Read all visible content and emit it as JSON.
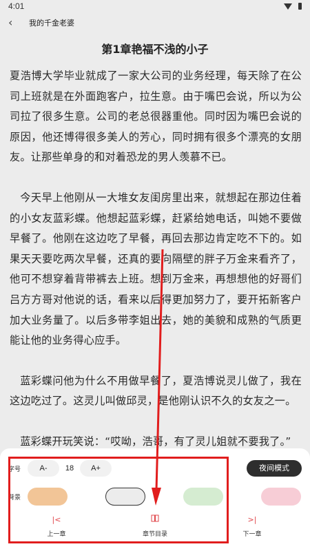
{
  "status_bar": {
    "time": "4:01",
    "icons": [
      "wifi-icon",
      "battery-icon"
    ]
  },
  "header": {
    "back_icon": "chevron-left-icon",
    "title": "我的千金老婆"
  },
  "chapter": {
    "title": "第1章艳福不浅的小子",
    "paragraphs": [
      "夏浩博大学毕业就成了一家大公司的业务经理，每天除了在公司上班就是在外面跑客户，拉生意。由于嘴巴会说，所以为公司拉了很多生意。公司的老总很器重他。同时因为嘴巴会说的原因，他还博得很多美人的芳心，同时拥有很多个漂亮的女朋友。让那些单身的和对着恐龙的男人羡慕不已。",
      "今天早上他刚从一大堆女友闺房里出来，就想起在那边住着的小女友蓝彩蝶。他想起蓝彩蝶，赶紧给她电话，叫她不要做早餐了。他刚在这边吃了早餐，再回去那边肯定吃不下的。如果天天要吃两次早餐，还真的要向隔壁的胖子万金来看齐了，他可不想穿着背带裤去上班。想到万金来，再想想他的好哥们吕方方哥对他说的话，看来以后得更加努力了，要开拓新客户加大业务量了。以后多带李姐出去，她的美貌和成熟的气质更能让他的业务得心应手。",
      "蓝彩蝶问他为什么不用做早餐了，夏浩博说灵儿做了，我在这边吃过了。这灵儿叫做邱灵，是他刚认识不久的女友之一。",
      "蓝彩蝶开玩笑说：“哎呦，浩哥，有了灵儿姐就不要我了。”"
    ]
  },
  "settings": {
    "font_label": "字号",
    "font_decrease": "A-",
    "font_size": "18",
    "font_increase": "A+",
    "night_mode": "夜间模式",
    "bg_label": "背景",
    "bg_swatches": [
      {
        "name": "orange",
        "color": "#f2c597"
      },
      {
        "name": "white",
        "color": "#ececec"
      },
      {
        "name": "green",
        "color": "#d5ecd1"
      },
      {
        "name": "pink",
        "color": "#f7cdd6"
      }
    ],
    "actions": [
      {
        "icon": "skip-previous-icon",
        "glyph": "|<",
        "label": "上一章"
      },
      {
        "icon": "book-icon",
        "glyph": "▯▯",
        "label": "章节目录"
      },
      {
        "icon": "skip-next-icon",
        "glyph": ">|",
        "label": "下一章"
      }
    ]
  },
  "colors": {
    "accent": "#e0454a",
    "annotation": "#e11d1d",
    "page_bg": "#ececec"
  }
}
